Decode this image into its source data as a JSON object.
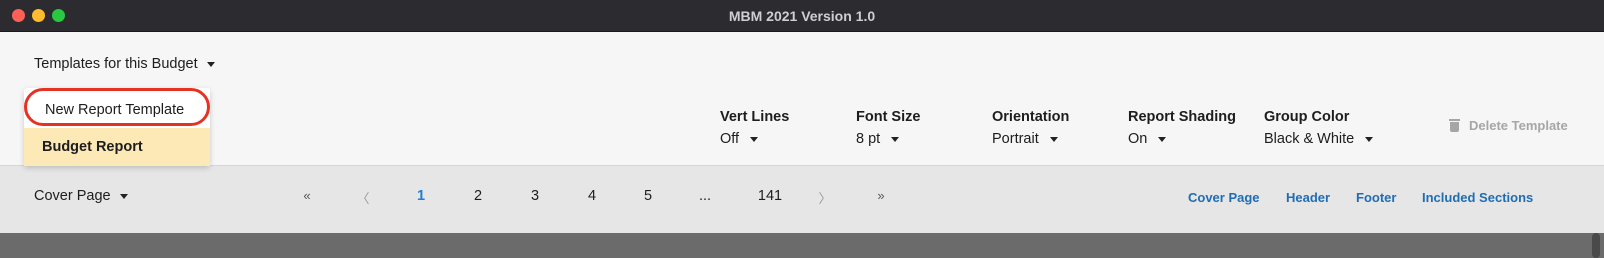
{
  "window": {
    "title": "MBM 2021 Version 1.0"
  },
  "toolbar": {
    "templates_dropdown": "Templates for this Budget",
    "menu": {
      "new_template": "New Report Template",
      "budget_report": "Budget Report"
    },
    "options": {
      "vert_lines": {
        "label": "Vert Lines",
        "value": "Off"
      },
      "font_size": {
        "label": "Font Size",
        "value": "8 pt"
      },
      "orientation": {
        "label": "Orientation",
        "value": "Portrait"
      },
      "report_shading": {
        "label": "Report Shading",
        "value": "On"
      },
      "group_color": {
        "label": "Group Color",
        "value": "Black & White"
      }
    },
    "delete_template": "Delete Template"
  },
  "subbar": {
    "cover_dropdown": "Cover Page",
    "pagination": {
      "first": "«",
      "prev": "〈",
      "pages": [
        "1",
        "2",
        "3",
        "4",
        "5",
        "...",
        "141"
      ],
      "current": "1",
      "next": "〉",
      "last": "»"
    },
    "links": {
      "cover_page": "Cover Page",
      "header": "Header",
      "footer": "Footer",
      "included_sections": "Included Sections"
    }
  },
  "colors": {
    "accent_link": "#1f6db5",
    "active_page": "#1f7fd0",
    "highlight_ring": "#e53222",
    "selected_item_bg": "#fde9b6"
  }
}
